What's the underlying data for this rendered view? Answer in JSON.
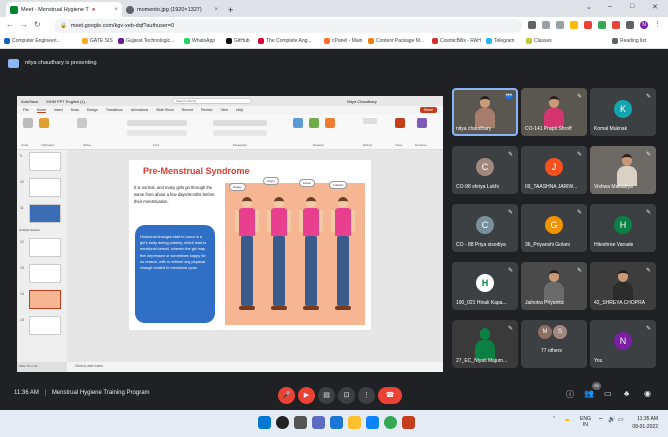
{
  "browser": {
    "tabs": [
      {
        "title": "Meet - Menstrual Hygiene T",
        "active": true
      },
      {
        "title": "momento.jpg (1920×1327)",
        "active": false
      }
    ],
    "new_tab": "+",
    "url": "meet.google.com/kgv-xeb-dqf?authuser=0",
    "bookmarks": [
      "Computer Engineeri...",
      "GATE SIS",
      "Gujarat Technologic...",
      "WhatsApp",
      "GitHub",
      "The Complete Ang...",
      "cPanel - Main",
      "Content Package M...",
      "CosmicBills - RAH",
      "Telegram",
      "Classes"
    ],
    "reading_list": "Reading list",
    "profile_initial": "N"
  },
  "meet": {
    "presenting_text": "nitya chaudhary is presenting",
    "meeting_time": "11:36 AM",
    "meeting_title": "Menstrual Hygiene Training Program",
    "participants": [
      {
        "name": "nitya chaudhary",
        "video": true
      },
      {
        "name": "CO-141 Prapti Shroff",
        "video": true
      },
      {
        "name": "Komal Muknak",
        "initial": "K",
        "color": "#12a4af"
      },
      {
        "name": "CO-98 shriya Lukhi",
        "initial": "C",
        "color": "#a1887f"
      },
      {
        "name": "09_TAASHNA JARIW...",
        "initial": "J",
        "color": "#f4511e"
      },
      {
        "name": "Vishwa Makadiya",
        "video": true
      },
      {
        "name": "CO - 88 Priya sisodiya",
        "initial": "C",
        "color": "#78909c"
      },
      {
        "name": "36_Priyanshi Golani",
        "initial": "G",
        "color": "#f09300"
      },
      {
        "name": "Hiteshree Varsale",
        "initial": "H",
        "color": "#0b8043"
      },
      {
        "name": "190_021 Hinali Kapa...",
        "initial": "H",
        "color": "#ffffff"
      },
      {
        "name": "Jaihotra Priyanka",
        "video": true
      },
      {
        "name": "42_SHREYA CHOPRA",
        "video": true
      },
      {
        "name": "27_EC_Niyati Majum...",
        "video": true
      },
      {
        "name": "77 others",
        "avatars": [
          "M",
          "S"
        ]
      },
      {
        "name": "You",
        "initial": "N",
        "color": "#7b1fa2"
      }
    ],
    "badge_count": "95"
  },
  "powerpoint": {
    "autosave": "AutoSave",
    "file_name": "MHM PPT English (1) -",
    "search_placeholder": "Search (Alt+Q)",
    "user": "Nitya Chaudhary",
    "share": "Share",
    "menu": [
      "File",
      "Home",
      "Insert",
      "Draw",
      "Design",
      "Transitions",
      "Animations",
      "Slide Show",
      "Record",
      "Review",
      "View",
      "Help"
    ],
    "ribbon_groups": [
      "Undo",
      "Clipboard",
      "Slides",
      "Font",
      "Paragraph",
      "Drawing",
      "Editing",
      "Voice",
      "Designer"
    ],
    "section_label": "Untitled Section",
    "notes_placeholder": "Click to add notes",
    "status_text": "Slide 15 of 26",
    "thumb_numbers": [
      "9",
      "10",
      "11",
      "12",
      "13",
      "14",
      "15"
    ],
    "slide": {
      "title": "Pre-Menstrual Syndrome",
      "intro": "It is normal, and many girls go through the same from about a few days/months before their menstruation.",
      "box": "Hormonal changes start to occur in a girl's body during puberty, which lead to emotional turmoil, wherein the girl may feel depressed or sometimes happy for no reason, with or without any physical change related to menstrual cycle.",
      "bubbles": [
        "Happy",
        "Angry",
        "Upset",
        "Irritated"
      ]
    }
  },
  "taskbar": {
    "lang": "ENG",
    "lang_sub": "IN",
    "time": "11:35 AM",
    "date": "08-01-2022"
  }
}
